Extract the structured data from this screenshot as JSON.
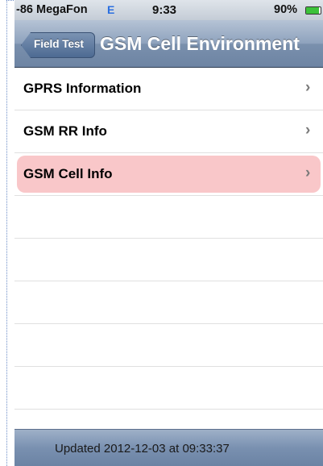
{
  "status_bar": {
    "carrier": "-86 MegaFon",
    "network_type": "E",
    "time": "9:33",
    "battery_percent": "90%",
    "battery_level": 0.9,
    "battery_color": "#3cc23a"
  },
  "nav": {
    "back_label": "Field Test",
    "title": "GSM Cell Environment"
  },
  "table": {
    "rows": [
      {
        "label": "GPRS Information",
        "chevron": "›",
        "selected": false
      },
      {
        "label": "GSM RR Info",
        "chevron": "›",
        "selected": false
      },
      {
        "label": "GSM Cell Info",
        "chevron": "›",
        "selected": true
      }
    ],
    "selected_color": "#f9c7c9"
  },
  "toolbar": {
    "updated_text": "Updated 2012-12-03 at 09:33:37"
  }
}
